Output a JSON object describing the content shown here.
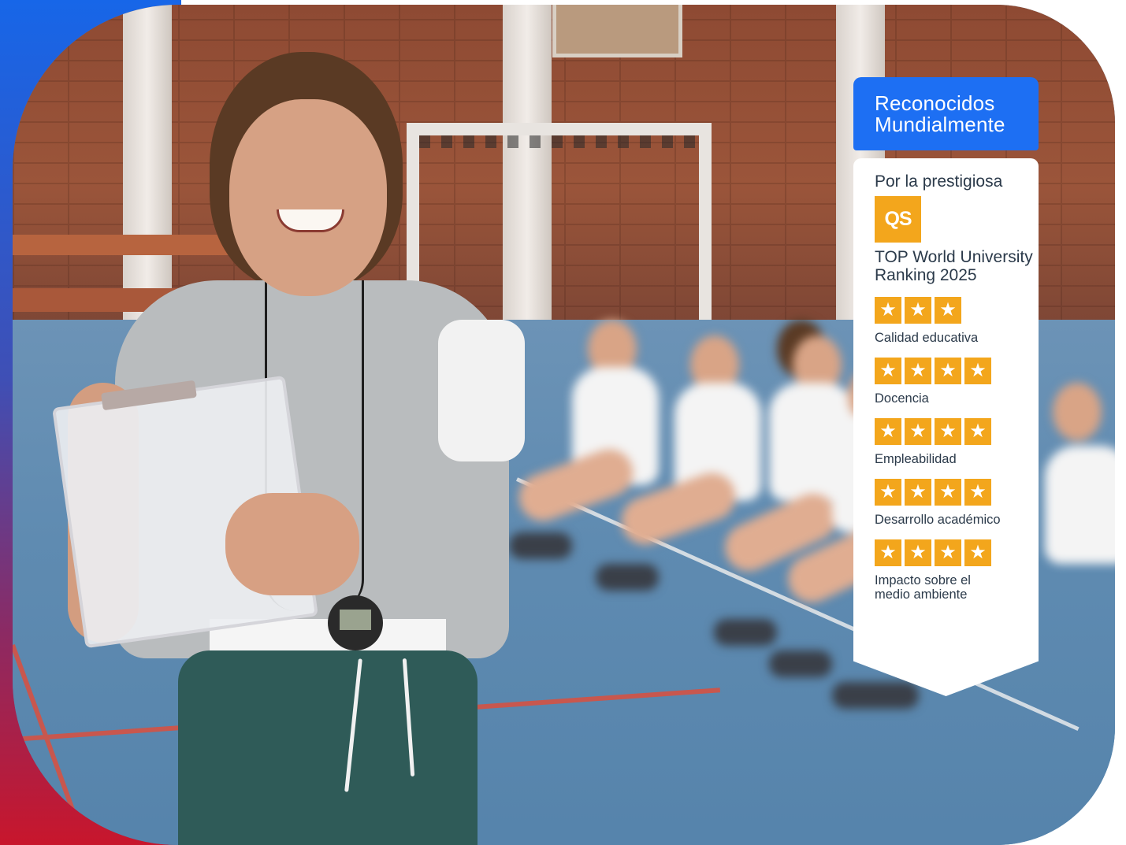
{
  "badge": {
    "header": "Reconocidos Mundialmente",
    "intro": "Por la prestigiosa",
    "logo_text": "QS",
    "ranking": "TOP World University Ranking 2025",
    "star_glyph": "★",
    "ratings": [
      {
        "label": "Calidad educativa",
        "stars": 3
      },
      {
        "label": "Docencia",
        "stars": 4
      },
      {
        "label": "Empleabilidad",
        "stars": 4
      },
      {
        "label": "Desarrollo académico",
        "stars": 4
      },
      {
        "label": "Impacto sobre el medio ambiente",
        "stars": 4
      }
    ]
  },
  "colors": {
    "brand_blue": "#1d6ff3",
    "star_gold": "#f3a61c",
    "text": "#2b3a4a"
  }
}
